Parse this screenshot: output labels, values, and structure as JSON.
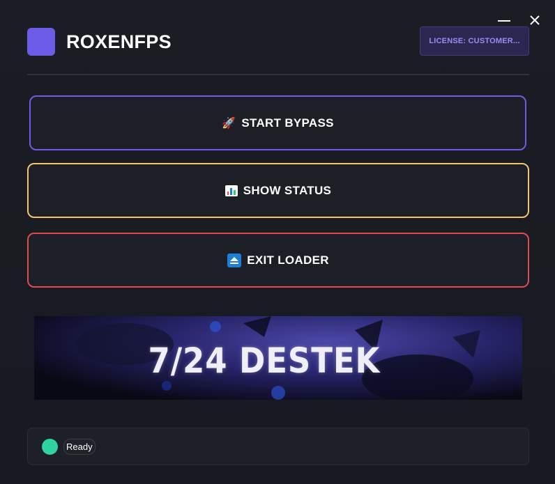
{
  "app": {
    "title": "ROXENFPS",
    "brand_color": "#6c5ce7"
  },
  "license": {
    "label": "LICENSE: CUSTOMER..."
  },
  "window_controls": {
    "minimize_icon": "minimize-icon",
    "close_icon": "close-icon",
    "close_glyph": "✕"
  },
  "buttons": {
    "start": {
      "icon": "rocket-icon",
      "glyph": "🚀",
      "label": "START BYPASS",
      "border_color": "#6c5ce7"
    },
    "status": {
      "icon": "bar-chart-icon",
      "label": "SHOW STATUS",
      "border_color": "#f6c56a"
    },
    "exit": {
      "icon": "eject-icon",
      "label": "EXIT LOADER",
      "border_color": "#e04a52"
    }
  },
  "banner": {
    "text": "7/24 DESTEK"
  },
  "status": {
    "text": "Ready",
    "indicator_color": "#2ed3a0"
  }
}
